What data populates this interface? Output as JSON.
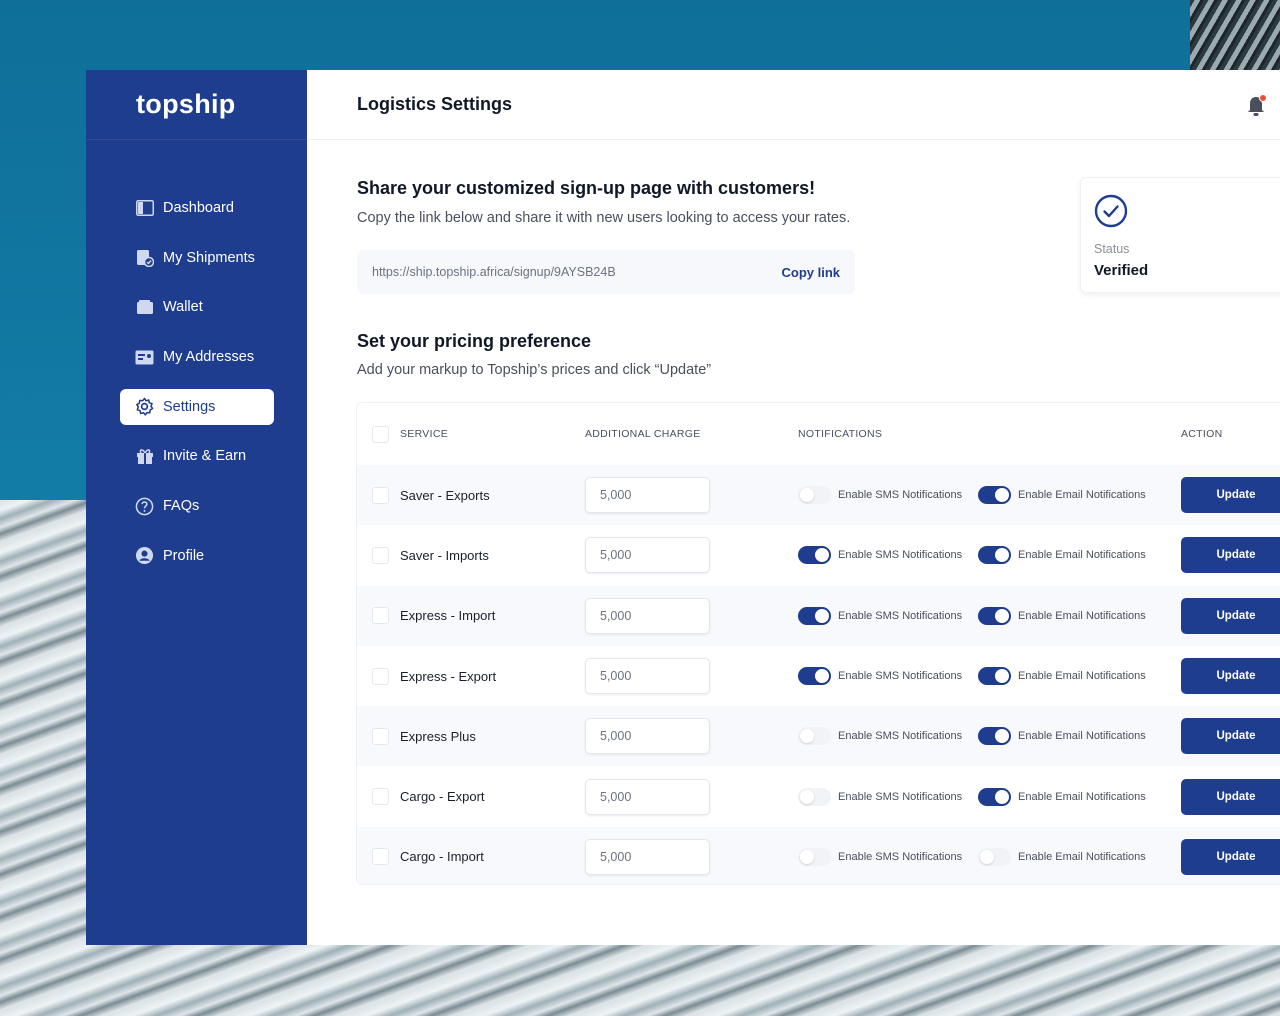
{
  "brand": {
    "name": "topship"
  },
  "sidebar": {
    "items": [
      {
        "label": "Dashboard",
        "icon": "dashboard-icon"
      },
      {
        "label": "My Shipments",
        "icon": "shipments-icon"
      },
      {
        "label": "Wallet",
        "icon": "wallet-icon"
      },
      {
        "label": "My Addresses",
        "icon": "address-card-icon"
      },
      {
        "label": "Settings",
        "icon": "gear-icon",
        "active": true
      },
      {
        "label": "Invite & Earn",
        "icon": "gift-icon"
      },
      {
        "label": "FAQs",
        "icon": "question-icon"
      },
      {
        "label": "Profile",
        "icon": "user-icon"
      }
    ]
  },
  "header": {
    "title": "Logistics Settings"
  },
  "share": {
    "title": "Share your customized sign-up page with customers!",
    "description": "Copy the link below and share it with new users looking to access your rates.",
    "url": "https://ship.topship.africa/signup/9AYSB24B",
    "copy_label": "Copy link"
  },
  "status": {
    "label": "Status",
    "value": "Verified"
  },
  "pricing": {
    "title": "Set your pricing preference",
    "description": "Add your markup to Topship’s prices and click “Update”"
  },
  "table": {
    "headers": {
      "service": "SERVICE",
      "charge": "ADDITIONAL CHARGE",
      "notifications": "NOTIFICATIONS",
      "action": "ACTION"
    },
    "sms_label": "Enable SMS Notifications",
    "email_label": "Enable Email Notifications",
    "update_label": "Update",
    "rows": [
      {
        "service": "Saver - Exports",
        "charge": "5,000",
        "sms": false,
        "email": true
      },
      {
        "service": "Saver - Imports",
        "charge": "5,000",
        "sms": true,
        "email": true
      },
      {
        "service": "Express - Import",
        "charge": "5,000",
        "sms": true,
        "email": true
      },
      {
        "service": "Express - Export",
        "charge": "5,000",
        "sms": true,
        "email": true
      },
      {
        "service": "Express Plus",
        "charge": "5,000",
        "sms": false,
        "email": true
      },
      {
        "service": "Cargo - Export",
        "charge": "5,000",
        "sms": false,
        "email": true
      },
      {
        "service": "Cargo - Import",
        "charge": "5,000",
        "sms": false,
        "email": false
      }
    ]
  },
  "colors": {
    "primary": "#1f3d8f",
    "notification_dot": "#e5533d"
  }
}
